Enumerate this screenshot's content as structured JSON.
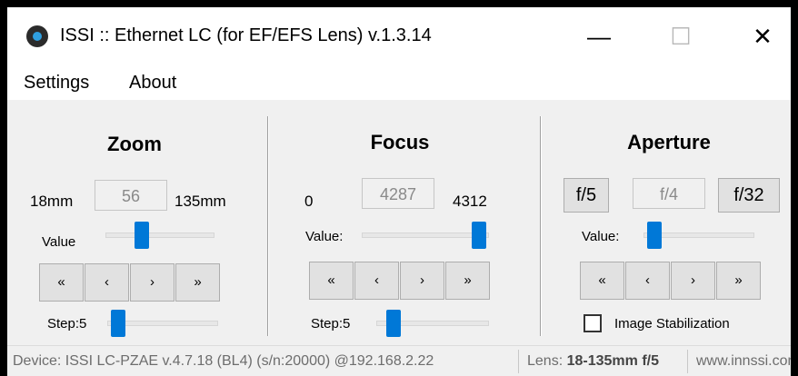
{
  "window": {
    "title": "ISSI :: Ethernet LC (for EF/EFS Lens) v.1.3.14",
    "minimize_glyph": "—",
    "maximize_glyph": "☐",
    "close_glyph": "✕"
  },
  "menu": {
    "settings": "Settings",
    "about": "About"
  },
  "zoom": {
    "heading": "Zoom",
    "min_label": "18mm",
    "value": "56",
    "max_label": "135mm",
    "value_label": "Value",
    "value_slider_fraction": 0.31,
    "nav": [
      "«",
      "‹",
      "›",
      "»"
    ],
    "step_label": "Step:5",
    "step_slider_fraction": 0.04
  },
  "focus": {
    "heading": "Focus",
    "min_label": "0",
    "value": "4287",
    "max_label": "4312",
    "value_label": "Value:",
    "value_slider_fraction": 0.99,
    "nav": [
      "«",
      "‹",
      "›",
      "»"
    ],
    "step_label": "Step:5",
    "step_slider_fraction": 0.1
  },
  "aperture": {
    "heading": "Aperture",
    "min_button": "f/5",
    "value": "f/4",
    "max_button": "f/32",
    "value_label": "Value:",
    "value_slider_fraction": 0.04,
    "nav": [
      "«",
      "‹",
      "›",
      "»"
    ],
    "stabilization_label": "Image Stabilization",
    "stabilization_checked": false
  },
  "status": {
    "device": "Device: ISSI LC-PZAE v.4.7.18 (BL4) (s/n:20000)  @192.168.2.22",
    "lens_prefix": "Lens: ",
    "lens_value": "18-135mm f/5",
    "website": "www.innssi.com"
  }
}
